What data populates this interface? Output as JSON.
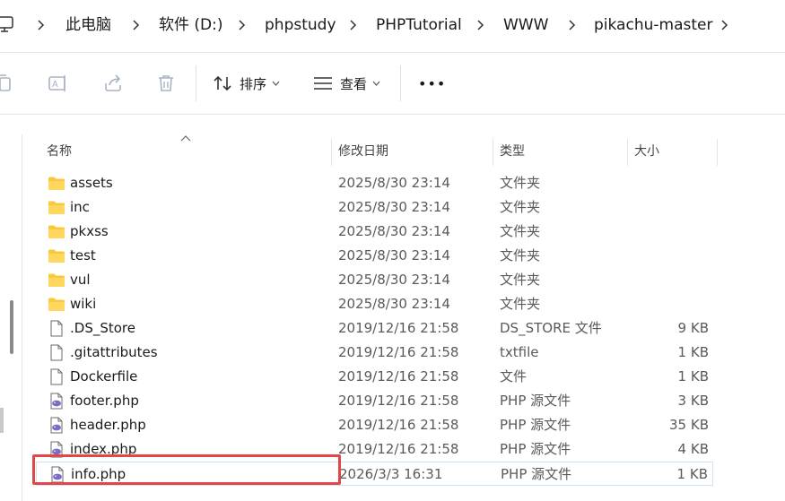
{
  "breadcrumb": {
    "computer_icon": "computer-icon",
    "items": [
      "此电脑",
      "软件 (D:)",
      "phpstudy",
      "PHPTutorial",
      "WWW",
      "pikachu-master"
    ]
  },
  "commandbar": {
    "icons": [
      "copy-icon",
      "rename-icon",
      "share-icon",
      "delete-icon"
    ],
    "sort_label": "排序",
    "view_label": "查看",
    "more_label": "•••"
  },
  "columns": {
    "name": "名称",
    "date": "修改日期",
    "type": "类型",
    "size": "大小"
  },
  "files": [
    {
      "name": "assets",
      "date": "2025/8/30 23:14",
      "type": "文件夹",
      "size": "",
      "icon": "folder-icon"
    },
    {
      "name": "inc",
      "date": "2025/8/30 23:14",
      "type": "文件夹",
      "size": "",
      "icon": "folder-icon"
    },
    {
      "name": "pkxss",
      "date": "2025/8/30 23:14",
      "type": "文件夹",
      "size": "",
      "icon": "folder-icon"
    },
    {
      "name": "test",
      "date": "2025/8/30 23:14",
      "type": "文件夹",
      "size": "",
      "icon": "folder-icon"
    },
    {
      "name": "vul",
      "date": "2025/8/30 23:14",
      "type": "文件夹",
      "size": "",
      "icon": "folder-icon"
    },
    {
      "name": "wiki",
      "date": "2025/8/30 23:14",
      "type": "文件夹",
      "size": "",
      "icon": "folder-icon"
    },
    {
      "name": ".DS_Store",
      "date": "2019/12/16 21:58",
      "type": "DS_STORE 文件",
      "size": "9 KB",
      "icon": "file-icon"
    },
    {
      "name": ".gitattributes",
      "date": "2019/12/16 21:58",
      "type": "txtfile",
      "size": "1 KB",
      "icon": "file-icon"
    },
    {
      "name": "Dockerfile",
      "date": "2019/12/16 21:58",
      "type": "文件",
      "size": "1 KB",
      "icon": "file-icon"
    },
    {
      "name": "footer.php",
      "date": "2019/12/16 21:58",
      "type": "PHP 源文件",
      "size": "3 KB",
      "icon": "php-file-icon"
    },
    {
      "name": "header.php",
      "date": "2019/12/16 21:58",
      "type": "PHP 源文件",
      "size": "35 KB",
      "icon": "php-file-icon"
    },
    {
      "name": "index.php",
      "date": "2019/12/16 21:58",
      "type": "PHP 源文件",
      "size": "4 KB",
      "icon": "php-file-icon"
    },
    {
      "name": "info.php",
      "date": "2026/3/3 16:31",
      "type": "PHP 源文件",
      "size": "1 KB",
      "icon": "php-file-icon"
    }
  ],
  "colors": {
    "highlight": "#e04848",
    "folder": "#f8c93c",
    "php_icon": "#7b6cc4"
  }
}
